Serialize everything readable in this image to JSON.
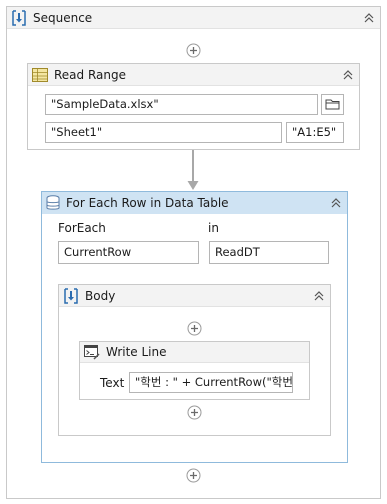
{
  "sequence": {
    "title": "Sequence"
  },
  "read_range": {
    "title": "Read Range",
    "workbook_path": "\"SampleData.xlsx\"",
    "sheet_name": "\"Sheet1\"",
    "range": "\"A1:E5\""
  },
  "for_each": {
    "title": "For Each Row in Data Table",
    "foreach_label": "ForEach",
    "in_label": "in",
    "item_variable": "CurrentRow",
    "datatable_variable": "ReadDT"
  },
  "body": {
    "title": "Body"
  },
  "write_line": {
    "title": "Write Line",
    "text_label": "Text",
    "text_value": "\"학번 : \" + CurrentRow(\"학번"
  },
  "colors": {
    "selected_border": "#8fbadc",
    "selected_header": "#cfe3f3",
    "frame_border": "#c9c9c9",
    "header_bg": "#f2f2f2"
  }
}
